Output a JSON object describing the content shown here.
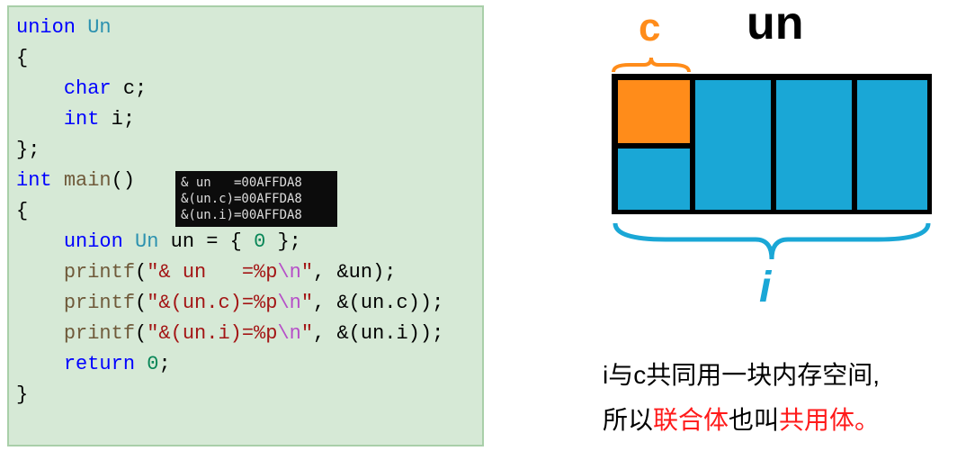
{
  "code": {
    "l1a": "union",
    "l1b": "Un",
    "l2": "{",
    "l3a": "char",
    "l3b": " c;",
    "l4a": "int",
    "l4b": " i;",
    "l5": "};",
    "l6a": "int",
    "l6b": "main",
    "l6c": "()",
    "l7": "{",
    "l8a": "union",
    "l8b": "Un",
    "l8c": " un = { ",
    "l8d": "0",
    "l8e": " };",
    "l9a": "printf",
    "l9b": "(",
    "l9c": "\"& un   =%p",
    "l9d": "\\n",
    "l9e": "\"",
    "l9f": ", &un);",
    "l10a": "printf",
    "l10b": "(",
    "l10c": "\"&(un.c)=%p",
    "l10d": "\\n",
    "l10e": "\"",
    "l10f": ", &(un.c));",
    "l11a": "printf",
    "l11b": "(",
    "l11c": "\"&(un.i)=%p",
    "l11d": "\\n",
    "l11e": "\"",
    "l11f": ", &(un.i));",
    "l12a": "return",
    "l12b": "0",
    "l12c": ";",
    "l13": "}"
  },
  "output": {
    "line1": "& un   =00AFFDA8",
    "line2": "&(un.c)=00AFFDA8",
    "line3": "&(un.i)=00AFFDA8"
  },
  "diagram": {
    "label_un": "un",
    "label_c": "c",
    "label_i": "i"
  },
  "caption": {
    "part1": "i与c共同用一块内存空间,",
    "part2a": "所以",
    "part2b": "联合体",
    "part2c": "也叫",
    "part2d": "共用体。"
  }
}
